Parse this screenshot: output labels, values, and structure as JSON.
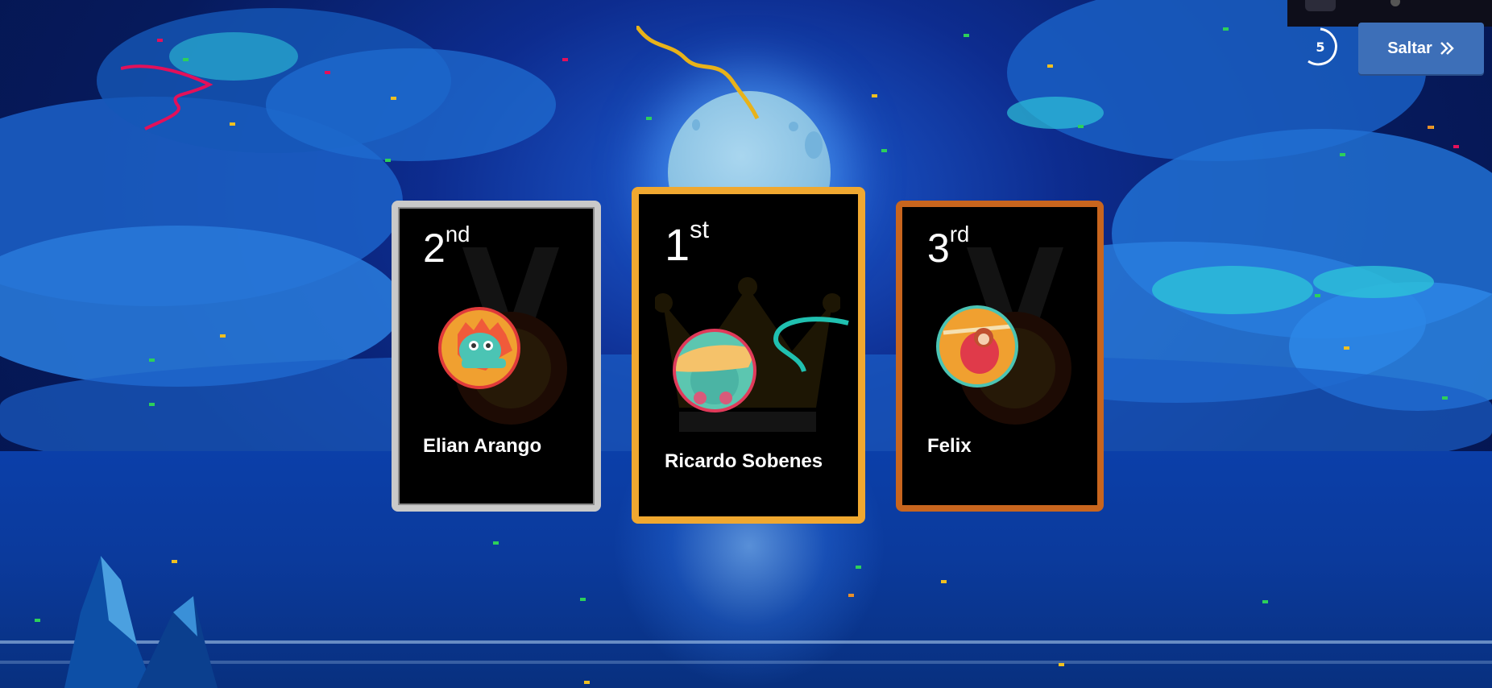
{
  "skip_button": {
    "label": "Saltar",
    "icon": "chevrons-right-icon"
  },
  "countdown": {
    "value": "5"
  },
  "podium": [
    {
      "rank_number": "2",
      "rank_suffix": "nd",
      "name": "Elian Arango",
      "avatar": "dinosaur-avatar",
      "frame_color": "#c9c9c9"
    },
    {
      "rank_number": "1",
      "rank_suffix": "st",
      "name": "Ricardo Sobenes",
      "avatar": "taco-avatar",
      "frame_color": "#f0a830"
    },
    {
      "rank_number": "3",
      "rank_suffix": "rd",
      "name": "Felix",
      "avatar": "sloth-avatar",
      "frame_color": "#c8651e"
    }
  ],
  "colors": {
    "sky": "#061a5c",
    "skip_button": "#3d6fb8",
    "silver": "#c9c9c9",
    "gold": "#f0a830",
    "bronze": "#c8651e"
  }
}
